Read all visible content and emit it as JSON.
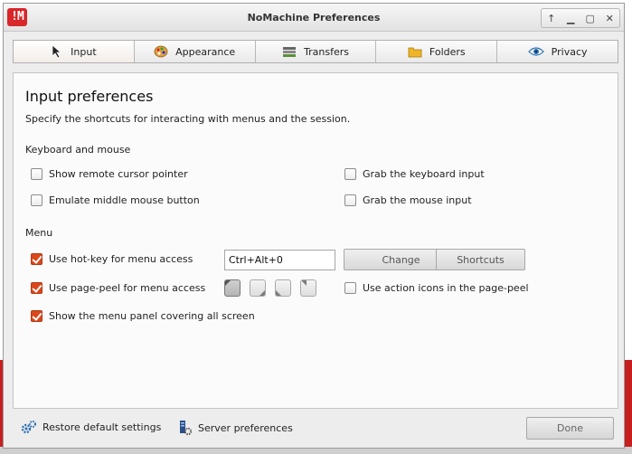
{
  "window": {
    "title": "NoMachine Preferences"
  },
  "tabs": [
    {
      "label": "Input",
      "icon": "cursor-icon",
      "active": true
    },
    {
      "label": "Appearance",
      "icon": "palette-icon",
      "active": false
    },
    {
      "label": "Transfers",
      "icon": "transfers-icon",
      "active": false
    },
    {
      "label": "Folders",
      "icon": "folder-icon",
      "active": false
    },
    {
      "label": "Privacy",
      "icon": "eye-icon",
      "active": false
    }
  ],
  "page": {
    "title": "Input preferences",
    "description": "Specify the shortcuts for interacting with menus and the session."
  },
  "keyboard": {
    "heading": "Keyboard and mouse",
    "show_remote_cursor": {
      "label": "Show remote cursor pointer",
      "checked": false
    },
    "emulate_middle": {
      "label": "Emulate middle mouse button",
      "checked": false
    },
    "grab_keyboard": {
      "label": "Grab the keyboard input",
      "checked": false
    },
    "grab_mouse": {
      "label": "Grab the mouse input",
      "checked": false
    }
  },
  "menu": {
    "heading": "Menu",
    "hotkey": {
      "label": "Use hot-key for menu access",
      "checked": true,
      "value": "Ctrl+Alt+0"
    },
    "change_label": "Change",
    "shortcuts_label": "Shortcuts",
    "pagepeel": {
      "label": "Use page-peel for menu access",
      "checked": true,
      "selected_corner": "top-left"
    },
    "action_icons": {
      "label": "Use action icons in the page-peel",
      "checked": false
    },
    "cover_screen": {
      "label": "Show the menu panel covering all screen",
      "checked": true
    }
  },
  "footer": {
    "restore_label": "Restore default settings",
    "server_label": "Server preferences",
    "done_label": "Done"
  },
  "colors": {
    "accent": "#d9471b",
    "logo": "#d8262a"
  }
}
